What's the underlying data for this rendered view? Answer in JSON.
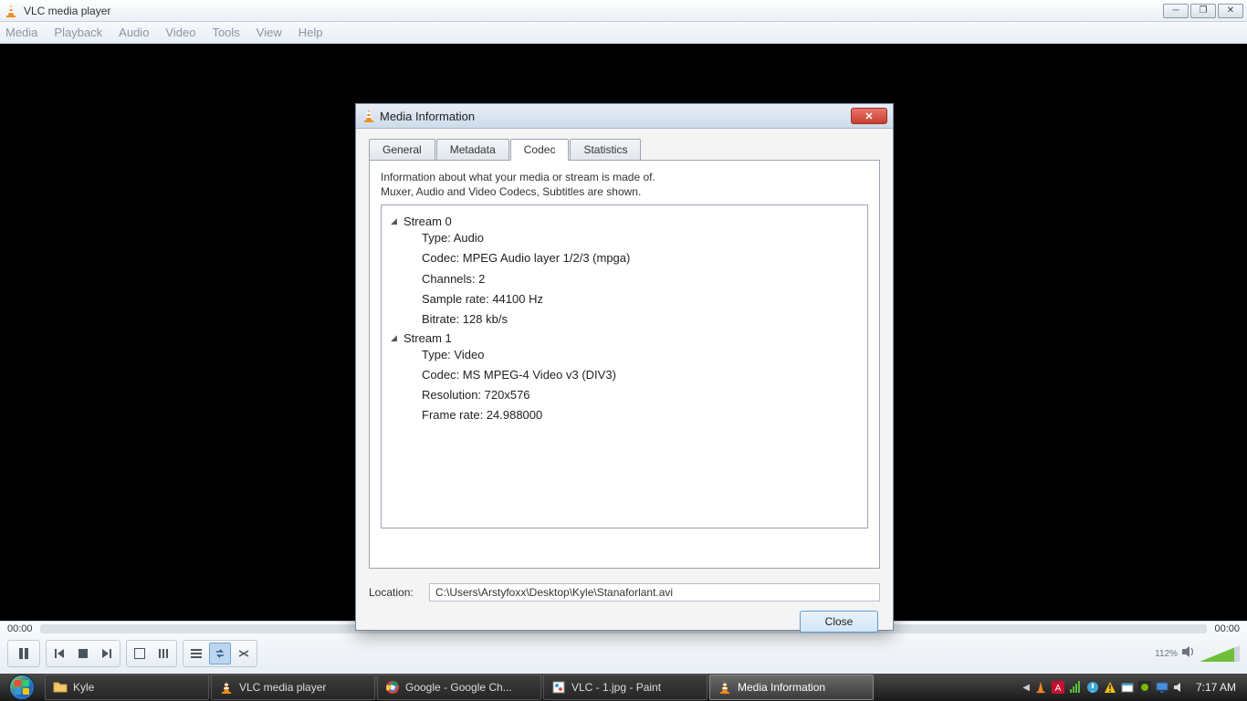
{
  "window": {
    "title": "VLC media player",
    "menus": [
      "Media",
      "Playback",
      "Audio",
      "Video",
      "Tools",
      "View",
      "Help"
    ]
  },
  "player": {
    "time_elapsed": "00:00",
    "time_total": "00:00",
    "volume_pct": "112%"
  },
  "dialog": {
    "title": "Media Information",
    "tabs": [
      "General",
      "Metadata",
      "Codec",
      "Statistics"
    ],
    "active_tab_index": 2,
    "desc_line1": "Information about what your media or stream is made of.",
    "desc_line2": "Muxer, Audio and Video Codecs, Subtitles are shown.",
    "streams": [
      {
        "name": "Stream 0",
        "details": [
          "Type: Audio",
          "Codec: MPEG Audio layer 1/2/3 (mpga)",
          "Channels: 2",
          "Sample rate: 44100 Hz",
          "Bitrate: 128 kb/s"
        ]
      },
      {
        "name": "Stream 1",
        "details": [
          "Type: Video",
          "Codec: MS MPEG-4 Video v3 (DIV3)",
          "Resolution: 720x576",
          "Frame rate: 24.988000"
        ]
      }
    ],
    "location_label": "Location:",
    "location_value": "C:\\Users\\Arstyfoxx\\Desktop\\Kyle\\Stanaforlant.avi",
    "close_label": "Close"
  },
  "taskbar": {
    "items": [
      {
        "label": "Kyle",
        "icon": "folder"
      },
      {
        "label": "VLC media player",
        "icon": "vlc"
      },
      {
        "label": "Google - Google Ch...",
        "icon": "chrome"
      },
      {
        "label": "VLC - 1.jpg - Paint",
        "icon": "paint"
      },
      {
        "label": "Media Information",
        "icon": "vlc",
        "active": true
      }
    ],
    "clock": "7:17 AM"
  }
}
